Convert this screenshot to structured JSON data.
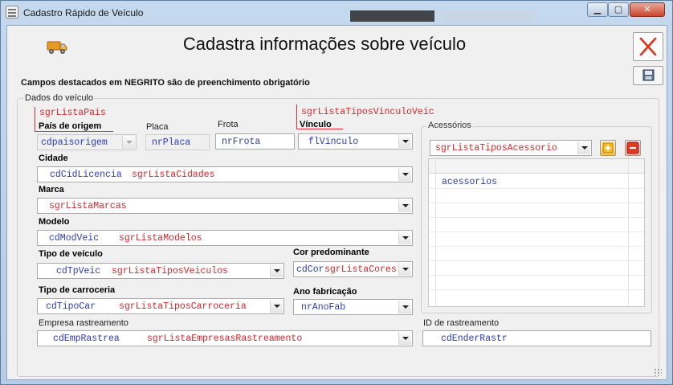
{
  "window": {
    "title": "Cadastro Rápido de Veículo"
  },
  "header": {
    "title": "Cadastra informações sobre veículo",
    "notice": "Campos destacados em NEGRITO são de preenchimento obrigatório"
  },
  "group": {
    "title": "Dados do veículo",
    "pais": {
      "label": "País de origem",
      "red": "sgrListaPais",
      "value": "cdpaisorigem"
    },
    "placa": {
      "label": "Placa",
      "value": "nrPlaca"
    },
    "frota": {
      "label": "Frota",
      "value": "nrFrota"
    },
    "vinculo": {
      "label": "Vínculo",
      "red": "sgrListaTiposVinculoVeic",
      "value": "flVinculo"
    },
    "cidade": {
      "label": "Cidade",
      "value": "cdCidLicencia",
      "red": "sgrListaCidades"
    },
    "marca": {
      "label": "Marca",
      "red": "sgrListaMarcas"
    },
    "modelo": {
      "label": "Modelo",
      "value": "cdModVeic",
      "red": "sgrListaModelos"
    },
    "tipo_veiculo": {
      "label": "Tipo de veículo",
      "value": "cdTpVeic",
      "red": "sgrListaTiposVeiculos"
    },
    "cor": {
      "label": "Cor predominante",
      "value": "cdCor",
      "red": "sgrListaCores"
    },
    "tipo_carroceria": {
      "label": "Tipo de carroceria",
      "value": "cdTipoCar",
      "red": "sgrListaTiposCarroceria"
    },
    "ano": {
      "label": "Ano fabricação",
      "value": "nrAnoFab"
    },
    "empresa": {
      "label": "Empresa rastreamento",
      "value": "cdEmpRastrea",
      "red": "sgrListaEmpresasRastreamento"
    },
    "id_rastreamento": {
      "label": "ID de rastreamento",
      "value": "cdEnderRastr"
    }
  },
  "acessorios": {
    "title": "Acessórios",
    "combo_red": "sgrListaTiposAcessorio",
    "list_value": "acessorios"
  },
  "colors": {
    "required_red": "#d9252a",
    "bound_blue": "#2d3bbf"
  }
}
